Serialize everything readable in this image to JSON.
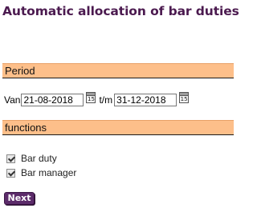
{
  "page": {
    "title": "Automatic allocation of bar duties"
  },
  "period": {
    "section_label": "Period",
    "from_label": "Van",
    "from_value": "21-08-2018",
    "to_label": "t/m",
    "to_value": "31-12-2018",
    "calendar_icon_text": "15"
  },
  "functions": {
    "section_label": "functions",
    "items": [
      {
        "label": "Bar duty",
        "checked": true
      },
      {
        "label": "Bar manager",
        "checked": true
      }
    ]
  },
  "actions": {
    "next_label": "Next"
  },
  "colors": {
    "title": "#4b1a4f",
    "section_bar": "#fdbf8a",
    "button": "#5c2b6a"
  }
}
